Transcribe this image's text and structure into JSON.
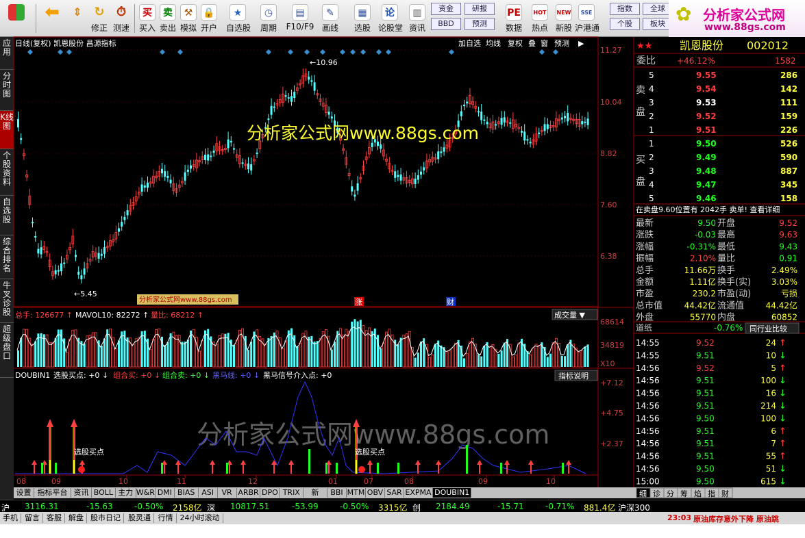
{
  "toolbar": {
    "buttons": [
      {
        "label": "买入",
        "color": "#d00000",
        "icon": "buy-icon",
        "glyph": "买"
      },
      {
        "label": "卖出",
        "color": "#008000",
        "icon": "sell-icon",
        "glyph": "卖"
      },
      {
        "label": "模拟",
        "color": "#a05000",
        "icon": "hammer-icon",
        "glyph": "⚒"
      },
      {
        "label": "开户",
        "color": "#555555",
        "icon": "lock-icon",
        "glyph": "🔒"
      },
      {
        "label": "自选股",
        "color": "#2060c0",
        "icon": "star-icon",
        "glyph": "★"
      },
      {
        "label": "周期",
        "color": "#3050a0",
        "icon": "clock-icon",
        "glyph": "◷"
      },
      {
        "label": "F10/F9",
        "color": "#3050a0",
        "icon": "f10-icon",
        "glyph": "▤"
      },
      {
        "label": "画线",
        "color": "#305090",
        "icon": "pen-icon",
        "glyph": "✎"
      },
      {
        "label": "选股",
        "color": "#3050a0",
        "icon": "select-stock-icon",
        "glyph": "▦"
      },
      {
        "label": "论股堂",
        "color": "#2050b0",
        "icon": "forum-icon",
        "glyph": "论"
      },
      {
        "label": "资讯",
        "color": "#555555",
        "icon": "news-icon",
        "glyph": "▥"
      },
      {
        "label": "数据",
        "color": "#c00000",
        "icon": "data-icon",
        "glyph": "PE"
      },
      {
        "label": "热点",
        "color": "#c00000",
        "icon": "hot-icon",
        "glyph": "HOT"
      },
      {
        "label": "新股",
        "color": "#c00000",
        "icon": "new-stock-icon",
        "glyph": "NEW"
      },
      {
        "label": "沪港通",
        "color": "#3050a0",
        "icon": "hk-icon",
        "glyph": "SSE"
      }
    ],
    "nav": {
      "back_label": "修正",
      "refresh_label": "测速",
      "f_label": "F10/F9"
    },
    "boxes": [
      "资金",
      "研报",
      "BBD",
      "预测",
      "指数",
      "全球",
      "个股",
      "板块"
    ],
    "logo_text": "分析家公式网",
    "logo_url": "www.88gs.com"
  },
  "left_tabs": [
    "应用",
    "分时图",
    "K线图",
    "个股资料",
    "自选股",
    "综合排名",
    "牛叉诊股",
    "超级盘口"
  ],
  "chart": {
    "header": "日线(复权)  凯恩股份  昌源指标",
    "header_buttons": [
      "加自选",
      "均线",
      "复权",
      "叠",
      "窗",
      "预测"
    ],
    "y_ticks": [
      "11.27",
      "10.04",
      "8.82",
      "7.60",
      "6.38"
    ],
    "high_label": "10.96",
    "low_label": "5.45",
    "watermark1": "分析家公式网www.88gs.com",
    "watermark_small": "分析家公式网www.88gs.com",
    "markers": [
      "涨",
      "财"
    ],
    "vol_header": {
      "total": "总手: 126677",
      "mavol": "MAVOL10: 82272",
      "ratio": "量比: 68212",
      "select": "成交量"
    },
    "vol_ticks": [
      "68614",
      "34819",
      "X10"
    ],
    "ind_header": {
      "name": "DOUBIN1",
      "a": "选股买点: +0",
      "b": "组合买: +0",
      "c": "组合卖: +0",
      "d": "黑马线: +0",
      "e": "黑马信号介入点: +0",
      "btn": "指标说明"
    },
    "ind_ticks": [
      "+7.12",
      "+4.75",
      "+2.37"
    ],
    "ind_labels": [
      "选股买点",
      "选股买点"
    ],
    "watermark2": "分析家公式网www.88gs.com",
    "months": [
      "08",
      "09",
      "10",
      "11",
      "12",
      "01",
      "07",
      "08",
      "09",
      "10"
    ]
  },
  "bottom_tabs": [
    "设置",
    "指标平台",
    "资讯",
    "BOLL",
    "主力",
    "W&R",
    "DMI",
    "BIAS",
    "ASI",
    "VR",
    "ARBR",
    "DPO",
    "TRIX",
    "新DMA",
    "BBI",
    "MTM",
    "OBV",
    "SAR",
    "EXPMA",
    "DOUBIN1"
  ],
  "right_tabs": [
    "细",
    "诊",
    "分",
    "筹",
    "焰",
    "指",
    "财"
  ],
  "quote": {
    "name": "凯恩股份",
    "code": "002012",
    "wei": {
      "label": "委比",
      "pct": "+46.12%",
      "diff": "1582"
    },
    "sell": [
      [
        "5",
        "9.55",
        "286"
      ],
      [
        "4",
        "9.54",
        "142"
      ],
      [
        "3",
        "9.53",
        "111"
      ],
      [
        "2",
        "9.52",
        "159"
      ],
      [
        "1",
        "9.51",
        "226"
      ]
    ],
    "buy": [
      [
        "1",
        "9.50",
        "526"
      ],
      [
        "2",
        "9.49",
        "590"
      ],
      [
        "3",
        "9.48",
        "887"
      ],
      [
        "4",
        "9.47",
        "345"
      ],
      [
        "5",
        "9.46",
        "158"
      ]
    ],
    "sell_label": "卖盘",
    "buy_label": "买盘",
    "notice": "在卖盘9.60位置有  2042手  卖单! 查看详细",
    "stats": [
      [
        "最新",
        "9.50",
        "开盘",
        "9.52"
      ],
      [
        "涨跌",
        "-0.03",
        "最高",
        "9.63"
      ],
      [
        "涨幅",
        "-0.31%",
        "最低",
        "9.43"
      ],
      [
        "振幅",
        "2.10%",
        "量比",
        "0.91"
      ],
      [
        "总手",
        "11.66万",
        "换手",
        "2.49%"
      ],
      [
        "金额",
        "1.11亿",
        "换手(实)",
        "3.03%"
      ],
      [
        "市盈",
        "230.2",
        "市盈(动)",
        "亏损"
      ],
      [
        "总市值",
        "44.42亿",
        "流通值",
        "44.42亿"
      ],
      [
        "外盘",
        "55770",
        "内盘",
        "60852"
      ]
    ],
    "industry": {
      "label": "道纸",
      "pct": "-0.76%",
      "btn": "同行业比较"
    },
    "ticks": [
      [
        "14:55",
        "9.52",
        "24",
        "up"
      ],
      [
        "14:55",
        "9.51",
        "10",
        "down"
      ],
      [
        "14:56",
        "9.52",
        "5",
        "up"
      ],
      [
        "14:56",
        "9.51",
        "100",
        "down"
      ],
      [
        "14:56",
        "9.51",
        "16",
        "down"
      ],
      [
        "14:56",
        "9.51",
        "214",
        "down"
      ],
      [
        "14:56",
        "9.50",
        "100",
        "down"
      ],
      [
        "14:56",
        "9.51",
        "6",
        "up"
      ],
      [
        "14:56",
        "9.51",
        "7",
        "up"
      ],
      [
        "14:56",
        "9.51",
        "55",
        "up"
      ],
      [
        "14:56",
        "9.50",
        "51",
        "down"
      ],
      [
        "15:00",
        "9.50",
        "615",
        "down"
      ]
    ]
  },
  "index_bar": [
    {
      "name": "沪",
      "value": "3116.31",
      "change": "-15.63",
      "pct": "-0.50%",
      "amount": "2158亿"
    },
    {
      "name": "深",
      "value": "10817.51",
      "change": "-53.99",
      "pct": "-0.50%",
      "amount": "3315亿"
    },
    {
      "name": "创",
      "value": "2184.49",
      "change": "-15.71",
      "pct": "-0.71%",
      "amount": "881.4亿"
    },
    {
      "name": "沪深300",
      "value": "",
      "change": "",
      "pct": "",
      "amount": ""
    }
  ],
  "status_bar": {
    "items": [
      "手机",
      "留言",
      "客服",
      "解盘",
      "股市日记",
      "股灵通",
      "行情",
      "24小时滚动"
    ],
    "time": "23:03",
    "news": "原油库存意外下降 原油跳"
  }
}
